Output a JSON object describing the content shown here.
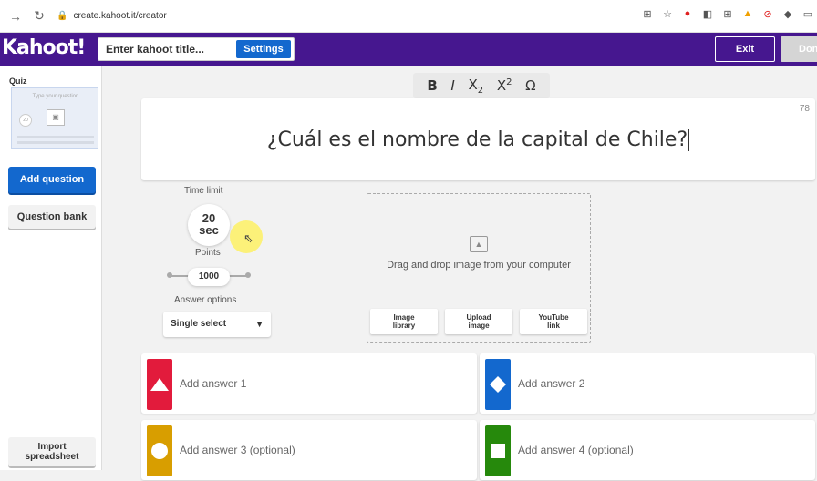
{
  "browser": {
    "back_icon": "arrow-right",
    "url": "create.kahoot.it/creator"
  },
  "app": {
    "logo": "Kahoot!",
    "title_placeholder": "Enter kahoot title...",
    "settings_label": "Settings",
    "exit_label": "Exit",
    "done_label": "Done"
  },
  "sidebar": {
    "section_label": "Quiz",
    "thumb_placeholder": "Type your question",
    "thumb_time": "20",
    "add_question_label": "Add question",
    "question_bank_label": "Question bank",
    "import_label_line1": "Import",
    "import_label_line2": "spreadsheet"
  },
  "toolbar": {
    "bold": "B",
    "italic": "I",
    "subscript_base": "X",
    "subscript": "2",
    "superscript_base": "X",
    "superscript": "2",
    "omega": "Ω"
  },
  "question": {
    "text": "¿Cuál es el nombre de la capital de Chile?",
    "char_count": "78"
  },
  "settings": {
    "time_limit_label": "Time limit",
    "time_value": "20",
    "time_unit": "sec",
    "points_label": "Points",
    "points_value": "1000",
    "answer_options_label": "Answer options",
    "answer_options_value": "Single select"
  },
  "media": {
    "drop_text": "Drag and drop image from your computer",
    "buttons": [
      {
        "line1": "Image",
        "line2": "library"
      },
      {
        "line1": "Upload",
        "line2": "image"
      },
      {
        "line1": "YouTube",
        "line2": "link"
      }
    ]
  },
  "answers": [
    {
      "placeholder": "Add answer 1",
      "shape": "triangle",
      "color": "#e21b3c"
    },
    {
      "placeholder": "Add answer 2",
      "shape": "diamond",
      "color": "#1368ce"
    },
    {
      "placeholder": "Add answer 3 (optional)",
      "shape": "circle",
      "color": "#d89e00"
    },
    {
      "placeholder": "Add answer 4 (optional)",
      "shape": "square",
      "color": "#26890c"
    }
  ],
  "colors": {
    "brand_purple": "#46178f",
    "primary_blue": "#1368ce"
  }
}
